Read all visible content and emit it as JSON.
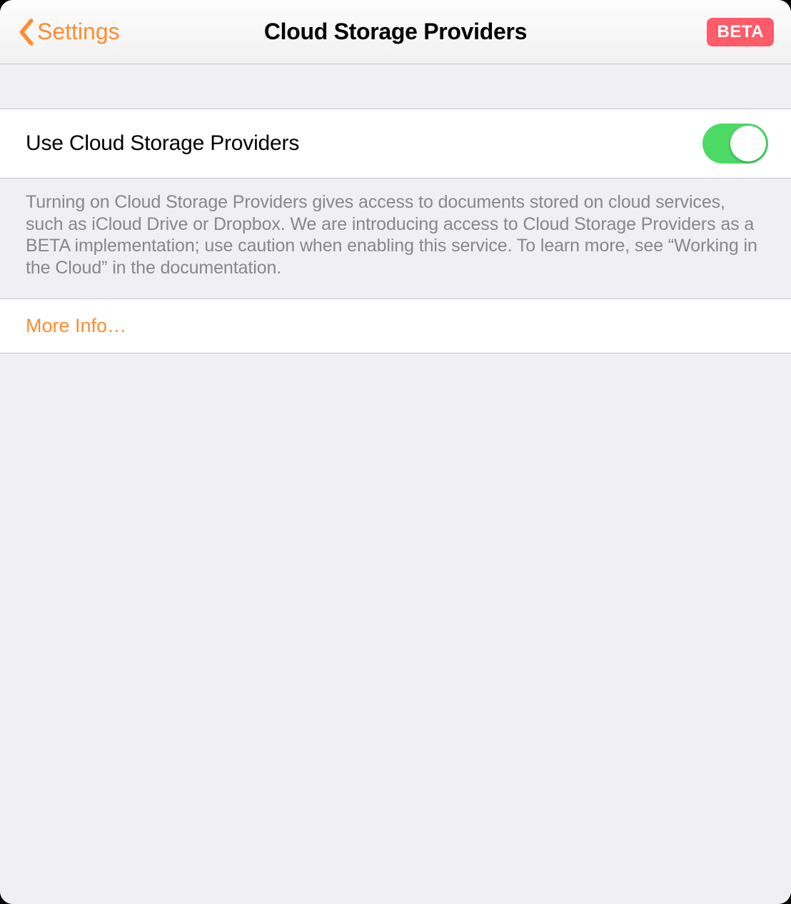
{
  "header": {
    "back_label": "Settings",
    "title": "Cloud Storage Providers",
    "badge": "BETA"
  },
  "main": {
    "toggle_label": "Use Cloud Storage Providers",
    "toggle_on": true,
    "description": "Turning on Cloud Storage Providers gives access to documents stored on cloud services, such as iCloud Drive or Dropbox. We are introducing access to Cloud Storage Providers as a BETA implementation; use caution when enabling this service. To learn more, see “Working in the Cloud” in the documentation.",
    "more_info_label": "More Info…"
  },
  "colors": {
    "accent": "#ff8c2e",
    "badge": "#ff5b69",
    "switch_on": "#4cd964",
    "background": "#efeff4",
    "separator": "#c8c7cc",
    "secondary_text": "#888888"
  }
}
